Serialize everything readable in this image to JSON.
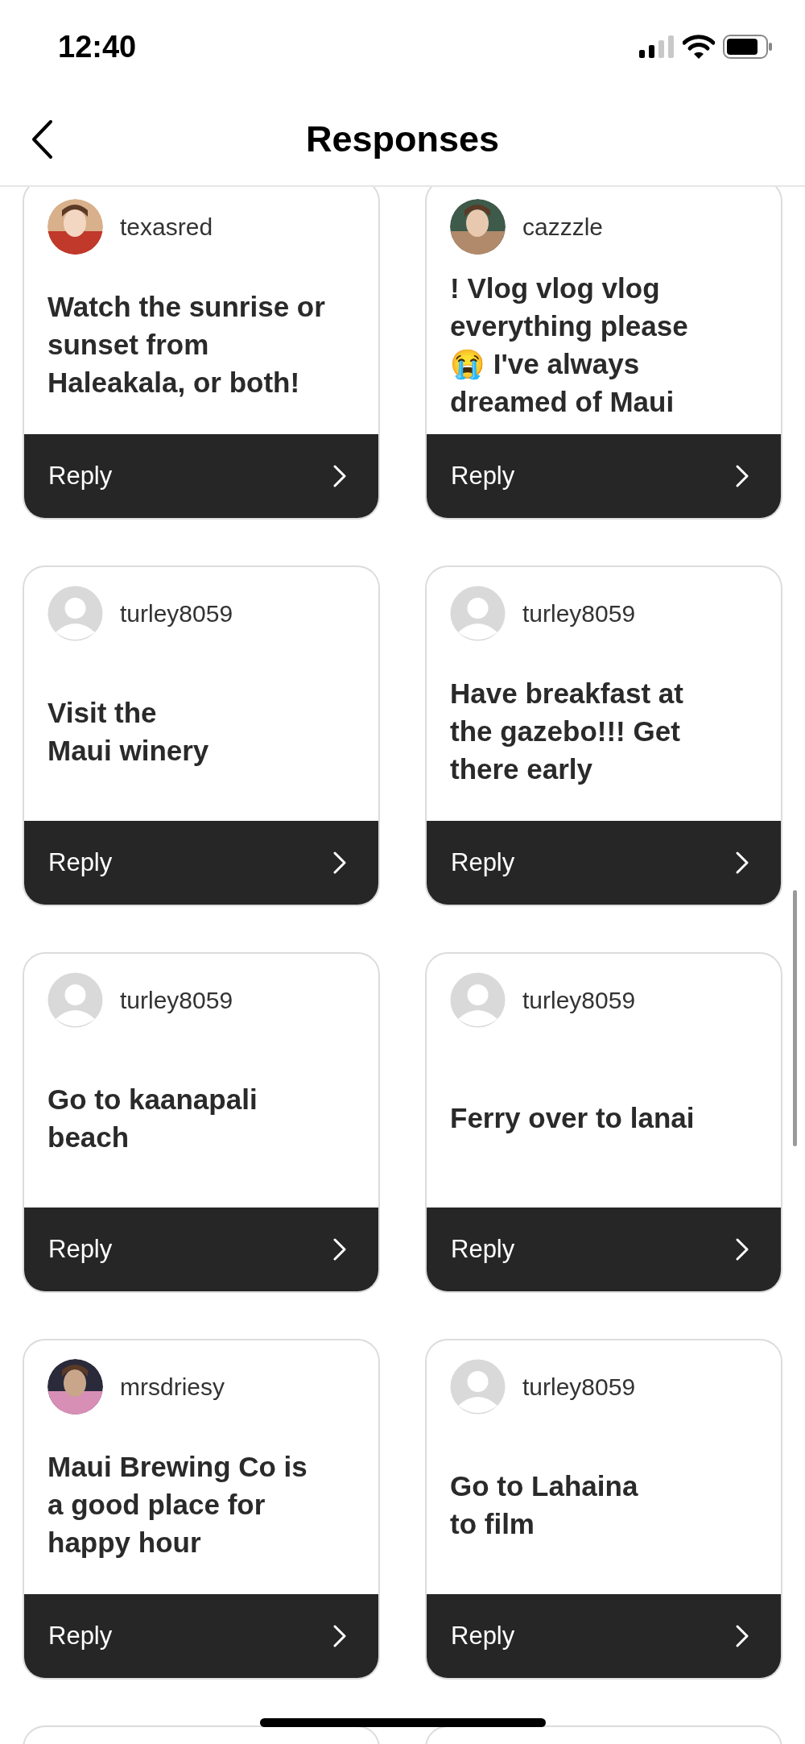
{
  "status_bar": {
    "time": "12:40"
  },
  "header": {
    "title": "Responses"
  },
  "cards": [
    {
      "username": "texasred",
      "kind": "picture",
      "text": "Watch the sunrise or sunset from Haleakala, or both!",
      "reply": "Reply"
    },
    {
      "username": "cazzzle",
      "kind": "picture",
      "text": "! Vlog vlog vlog everything please 😭 I've always dreamed of Maui",
      "reply": "Reply"
    },
    {
      "username": "turley8059",
      "kind": "default",
      "text": "Visit the\nMaui winery",
      "reply": "Reply"
    },
    {
      "username": "turley8059",
      "kind": "default",
      "text": "Have breakfast at the gazebo!!!  Get there early",
      "reply": "Reply"
    },
    {
      "username": "turley8059",
      "kind": "default",
      "text": "Go to kaanapali beach",
      "reply": "Reply"
    },
    {
      "username": "turley8059",
      "kind": "default",
      "text": "Ferry over to lanai",
      "reply": "Reply"
    },
    {
      "username": "mrsdriesy",
      "kind": "picture",
      "text": "Maui Brewing Co is a good place for happy hour",
      "reply": "Reply"
    },
    {
      "username": "turley8059",
      "kind": "default",
      "text": "Go to Lahaina\nto film",
      "reply": "Reply"
    }
  ]
}
